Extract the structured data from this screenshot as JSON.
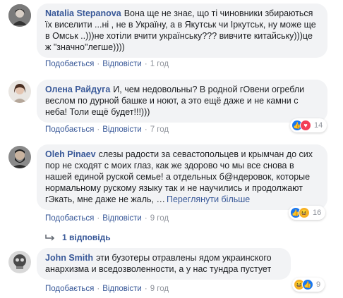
{
  "actions": {
    "like": "Подобається",
    "reply": "Відповісти",
    "separator": "·"
  },
  "comments": [
    {
      "author": "Natalia Stepanova",
      "text": "Вона ще не знає, що ті чиновники збираються їх виселити ...ні , не в Україну, а в Якутськ чи Іркутськ, ну може ще в Омськ ..)))не хотіли вчити українську??? вивчите китайську)))це ж \"значно\"легше))))",
      "time": "1 год",
      "avatar_icon": "user-photo-icon"
    },
    {
      "author": "Олена Райдуга",
      "text": "И, чем недовольны? В родной гОвени огребли веслом по дурной башке и ноют, а это ещё даже и не камни с неба! Толи ещё будет!!!)))",
      "time": "7 год",
      "reaction_count": "14",
      "avatar_icon": "user-photo-icon"
    },
    {
      "author": "Oleh Pinaev",
      "text": "слезы радости за севастопольцев и крымчан до сих пор не сходят с моих глаз, как же здорово чо мы все снова в нашей единой руской семье! а отдельных б@ндеровок, которые нормальному рускому языку так и не научились и продолжают гЭкать, мне даже не жаль, …",
      "see_more": "Переглянути більше",
      "time": "9 год",
      "reaction_count": "16",
      "replies_label": "1 відповідь",
      "avatar_icon": "user-photo-icon"
    },
    {
      "author": "John Smith",
      "text": "эти бузотеры отравлены ядом украинского анархизма и вседозволенности, а у нас тундра пустует",
      "time": "9 год",
      "reaction_count": "9",
      "avatar_icon": "user-photo-icon"
    }
  ],
  "colors": {
    "link": "#385898",
    "bubble": "#f2f3f5",
    "meta": "#90949c",
    "like": "#1877f2",
    "love": "#f33e58",
    "haha": "#f7b125"
  }
}
